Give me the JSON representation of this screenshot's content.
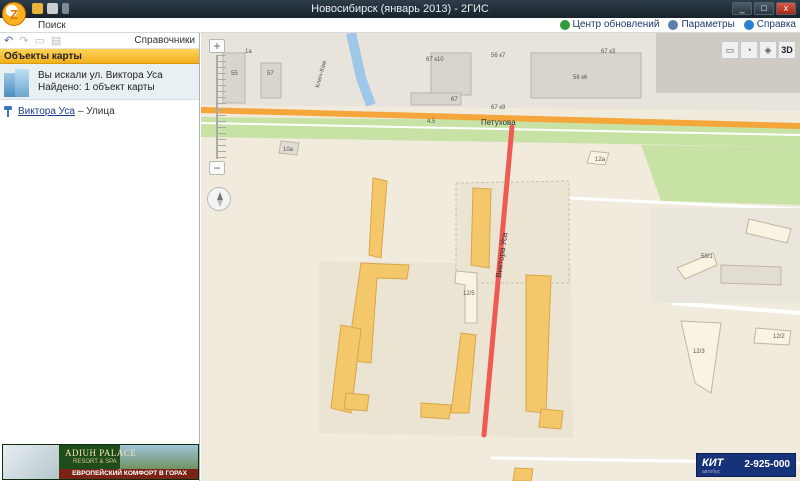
{
  "window": {
    "title": "Новосибирск (январь 2013) - 2ГИС",
    "controls": [
      "_",
      "□",
      "x"
    ]
  },
  "menubar": {
    "search_tab": "Поиск",
    "items": [
      {
        "label": "Центр обновлений",
        "icon": "update-icon",
        "color": "#2f9b3b"
      },
      {
        "label": "Параметры",
        "icon": "settings-icon",
        "color": "#5b7fb0"
      },
      {
        "label": "Справка",
        "icon": "help-icon",
        "color": "#2a7fd4"
      }
    ]
  },
  "left_panel": {
    "nav": {
      "back": "↶",
      "forward": "↷",
      "directories": "Справочники"
    },
    "section_header": "Объекты карты",
    "search_result": {
      "line1": "Вы искали ул. Виктора Уса",
      "line2": "Найдено: 1 объект карты"
    },
    "street": {
      "name": "Виктора Уса",
      "type": "– Улица"
    },
    "banner": {
      "brand": "ADIUH PALACE",
      "brand_sub": "RESORT & SPA",
      "slogan": "ЕВРОПЕЙСКИЙ КОМФОРТ В ГОРАХ КАВКАЗА!"
    }
  },
  "map": {
    "controls": [
      "▭",
      "◔",
      "◈",
      "3D"
    ],
    "road_labels": [
      "Петухова",
      "Виктора Уса",
      "Ключ-Кам."
    ],
    "route_number": "4.5",
    "building_numbers": [
      "1а",
      "55",
      "57",
      "67 к10",
      "56 к7",
      "67 к3",
      "56 к6",
      "67",
      "67 к9",
      "10а",
      "12а",
      "58/1",
      "12/5",
      "12/2",
      "12/3"
    ],
    "ad": {
      "logo": "КИТ",
      "phone": "2-925-000",
      "sub": "автобус"
    },
    "colors": {
      "highlight": "#ef5a54",
      "green": "#c8e2a5",
      "road": "#f4a63b",
      "building": "#f3c76a"
    }
  }
}
